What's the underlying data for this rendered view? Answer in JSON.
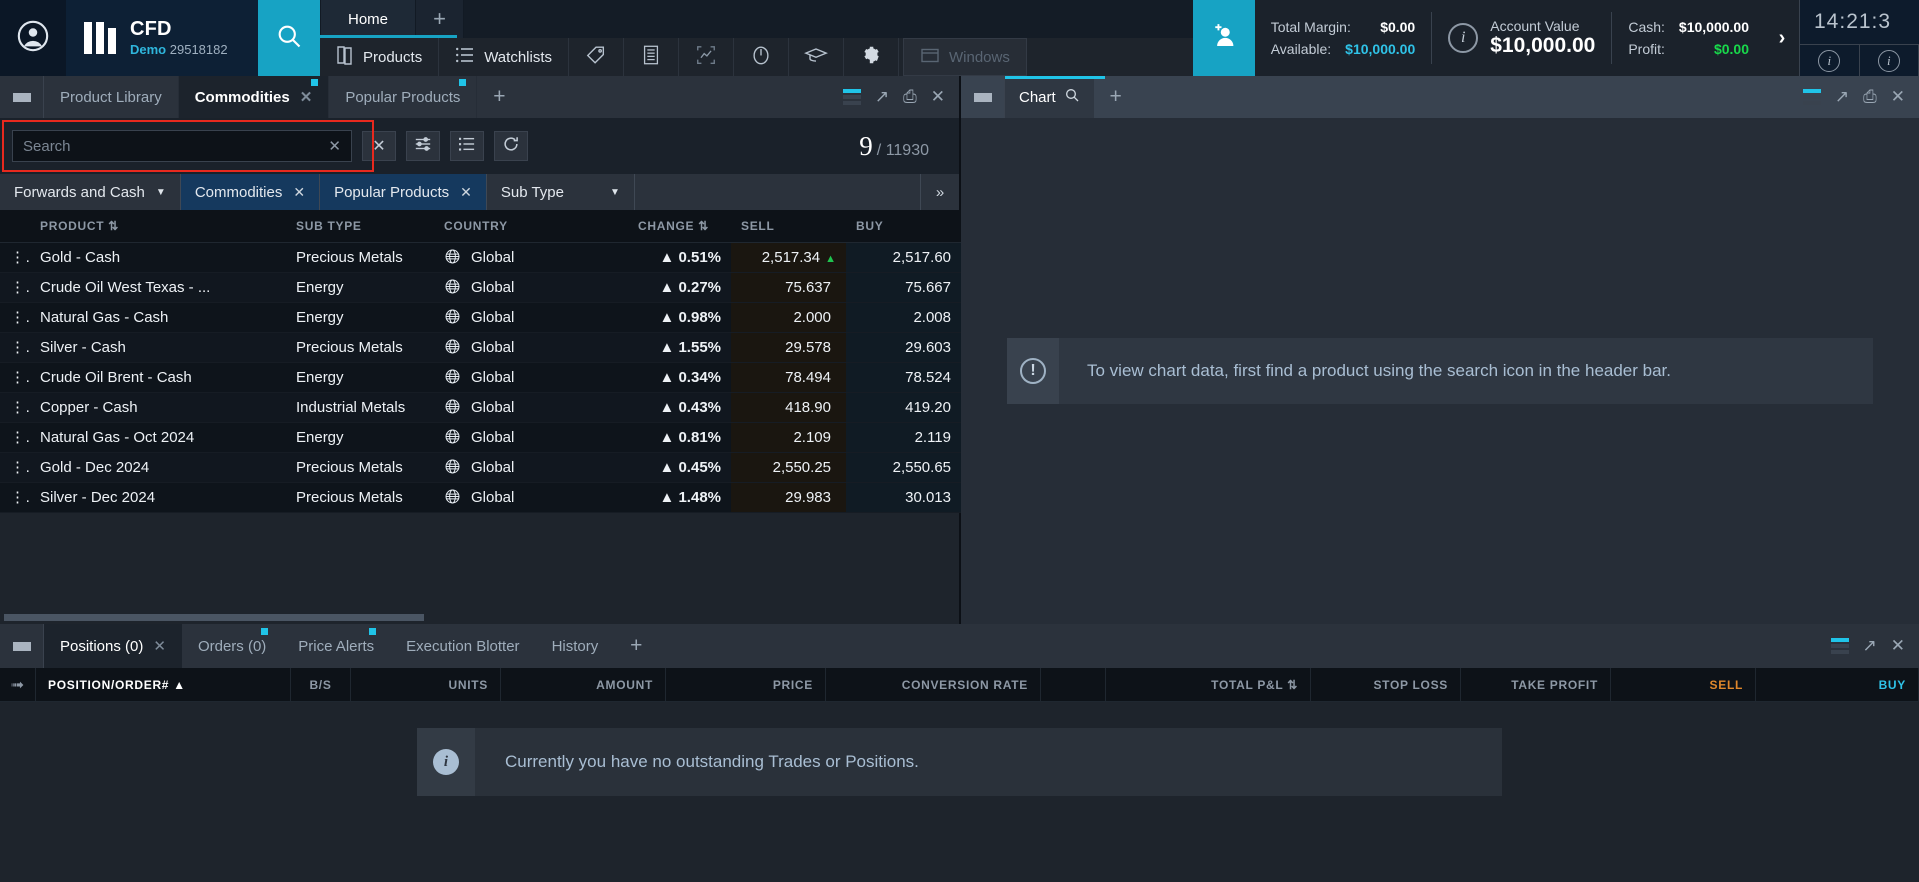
{
  "header": {
    "brand": {
      "title": "CFD",
      "demo_label": "Demo",
      "account_number": "29518182"
    },
    "avatar_icon": "user-avatar-icon",
    "search_icon": "search-icon",
    "add_user_icon": "add-user-icon",
    "tabs": [
      {
        "label": "Home"
      }
    ],
    "tab_add_label": "+",
    "nav": {
      "products_label": "Products",
      "watchlists_label": "Watchlists",
      "windows_label": "Windows",
      "icons": [
        "tag-icon",
        "news-document-icon",
        "chart-expand-icon",
        "gauge-clock-icon",
        "graduation-cap-icon",
        "gear-icon"
      ]
    },
    "account": {
      "total_margin_label": "Total Margin:",
      "total_margin_value": "$0.00",
      "available_label": "Available:",
      "available_value": "$10,000.00",
      "account_value_label": "Account Value",
      "account_value_amount": "$10,000.00",
      "cash_label": "Cash:",
      "cash_value": "$10,000.00",
      "profit_label": "Profit:",
      "profit_value": "$0.00"
    },
    "clock": "14:21:3",
    "expand_chevron": "›"
  },
  "products_panel": {
    "tabs": [
      {
        "label": "Product Library",
        "active": false,
        "closable": false,
        "dot": false
      },
      {
        "label": "Commodities",
        "active": true,
        "closable": true,
        "dot": true
      },
      {
        "label": "Popular Products",
        "active": false,
        "closable": false,
        "dot": true
      }
    ],
    "add_tab_label": "+",
    "search": {
      "placeholder": "Search",
      "value": ""
    },
    "toolbar_buttons": [
      "clear-search-x",
      "filter-sliders-icon",
      "list-view-icon",
      "refresh-icon"
    ],
    "count": {
      "shown": "9",
      "total": "/ 11930"
    },
    "filters": [
      {
        "label": "Forwards and Cash",
        "type": "dropdown",
        "selected": false
      },
      {
        "label": "Commodities",
        "type": "chip",
        "selected": true
      },
      {
        "label": "Popular Products",
        "type": "chip",
        "selected": true
      },
      {
        "label": "Sub Type",
        "type": "dropdown",
        "selected": false
      }
    ],
    "filter_more_label": "»",
    "columns": [
      "PRODUCT",
      "SUB TYPE",
      "COUNTRY",
      "CHANGE",
      "SELL",
      "BUY"
    ],
    "rows": [
      {
        "product": "Gold - Cash",
        "sub_type": "Precious Metals",
        "country": "Global",
        "change": "▲ 0.51%",
        "sell": "2,517.34",
        "sell_tick": "▲",
        "buy": "2,517.60"
      },
      {
        "product": "Crude Oil West Texas - ...",
        "sub_type": "Energy",
        "country": "Global",
        "change": "▲ 0.27%",
        "sell": "75.637",
        "sell_tick": "",
        "buy": "75.667"
      },
      {
        "product": "Natural Gas - Cash",
        "sub_type": "Energy",
        "country": "Global",
        "change": "▲ 0.98%",
        "sell": "2.000",
        "sell_tick": "",
        "buy": "2.008"
      },
      {
        "product": "Silver - Cash",
        "sub_type": "Precious Metals",
        "country": "Global",
        "change": "▲ 1.55%",
        "sell": "29.578",
        "sell_tick": "",
        "buy": "29.603"
      },
      {
        "product": "Crude Oil Brent - Cash",
        "sub_type": "Energy",
        "country": "Global",
        "change": "▲ 0.34%",
        "sell": "78.494",
        "sell_tick": "",
        "buy": "78.524"
      },
      {
        "product": "Copper - Cash",
        "sub_type": "Industrial Metals",
        "country": "Global",
        "change": "▲ 0.43%",
        "sell": "418.90",
        "sell_tick": "",
        "buy": "419.20"
      },
      {
        "product": "Natural Gas - Oct 2024",
        "sub_type": "Energy",
        "country": "Global",
        "change": "▲ 0.81%",
        "sell": "2.109",
        "sell_tick": "",
        "buy": "2.119"
      },
      {
        "product": "Gold - Dec 2024",
        "sub_type": "Precious Metals",
        "country": "Global",
        "change": "▲ 0.45%",
        "sell": "2,550.25",
        "sell_tick": "",
        "buy": "2,550.65"
      },
      {
        "product": "Silver - Dec 2024",
        "sub_type": "Precious Metals",
        "country": "Global",
        "change": "▲ 1.48%",
        "sell": "29.983",
        "sell_tick": "",
        "buy": "30.013"
      }
    ]
  },
  "chart_panel": {
    "tab_label": "Chart",
    "add_tab_label": "+",
    "empty_message": "To view chart data, first find a product using the search icon in the header bar."
  },
  "positions_panel": {
    "tabs": [
      {
        "label": "Positions (0)",
        "active": true,
        "closable": true,
        "dot": false
      },
      {
        "label": "Orders (0)",
        "active": false,
        "closable": false,
        "dot": true
      },
      {
        "label": "Price Alerts",
        "active": false,
        "closable": false,
        "dot": true
      },
      {
        "label": "Execution Blotter",
        "active": false,
        "closable": false,
        "dot": false
      },
      {
        "label": "History",
        "active": false,
        "closable": false,
        "dot": false
      }
    ],
    "add_tab_label": "+",
    "columns": [
      "POSITION/ORDER# ▲",
      "B/S",
      "UNITS",
      "AMOUNT",
      "PRICE",
      "CONVERSION RATE",
      "TOTAL P&L ⇅",
      "STOP LOSS",
      "TAKE PROFIT",
      "SELL",
      "BUY"
    ],
    "empty_message": "Currently you have no outstanding Trades or Positions."
  },
  "colors": {
    "accent_cyan": "#17a3c4",
    "up_green": "#20c55a",
    "sell_orange": "#e0872b",
    "buy_cyan": "#2fc3e8",
    "highlight_red": "#e8291e"
  }
}
